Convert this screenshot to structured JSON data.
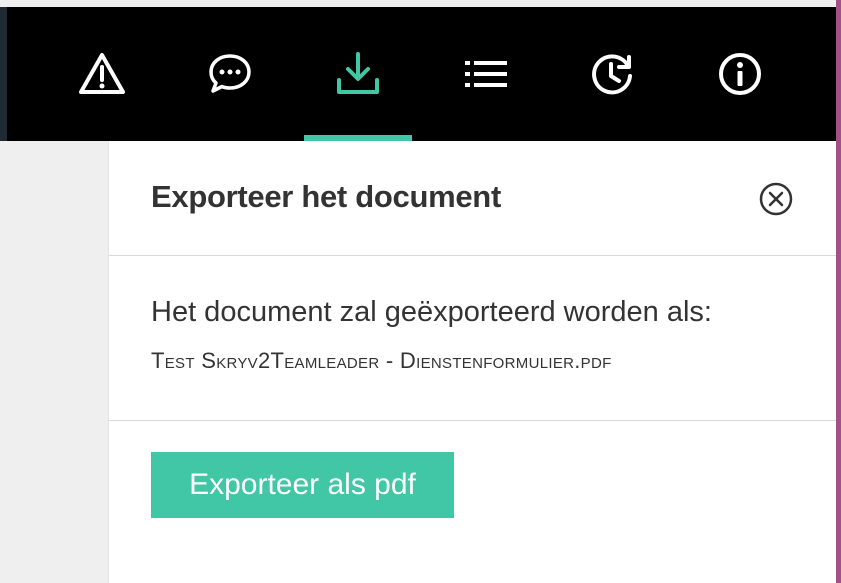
{
  "toolbar": {
    "tools": [
      {
        "icon": "warning-icon",
        "active": false
      },
      {
        "icon": "chat-icon",
        "active": false
      },
      {
        "icon": "download-icon",
        "active": true
      },
      {
        "icon": "list-icon",
        "active": false
      },
      {
        "icon": "history-icon",
        "active": false
      },
      {
        "icon": "info-icon",
        "active": false
      }
    ],
    "accent_color": "#41c6a6"
  },
  "panel": {
    "title": "Exporteer het document",
    "description": "Het document zal geëxporteerd worden als:",
    "filename": "Test Skryv2Teamleader - Dienstenformulier.pdf",
    "export_button_label": "Exporteer als pdf",
    "close_icon": "close-circle-icon"
  }
}
